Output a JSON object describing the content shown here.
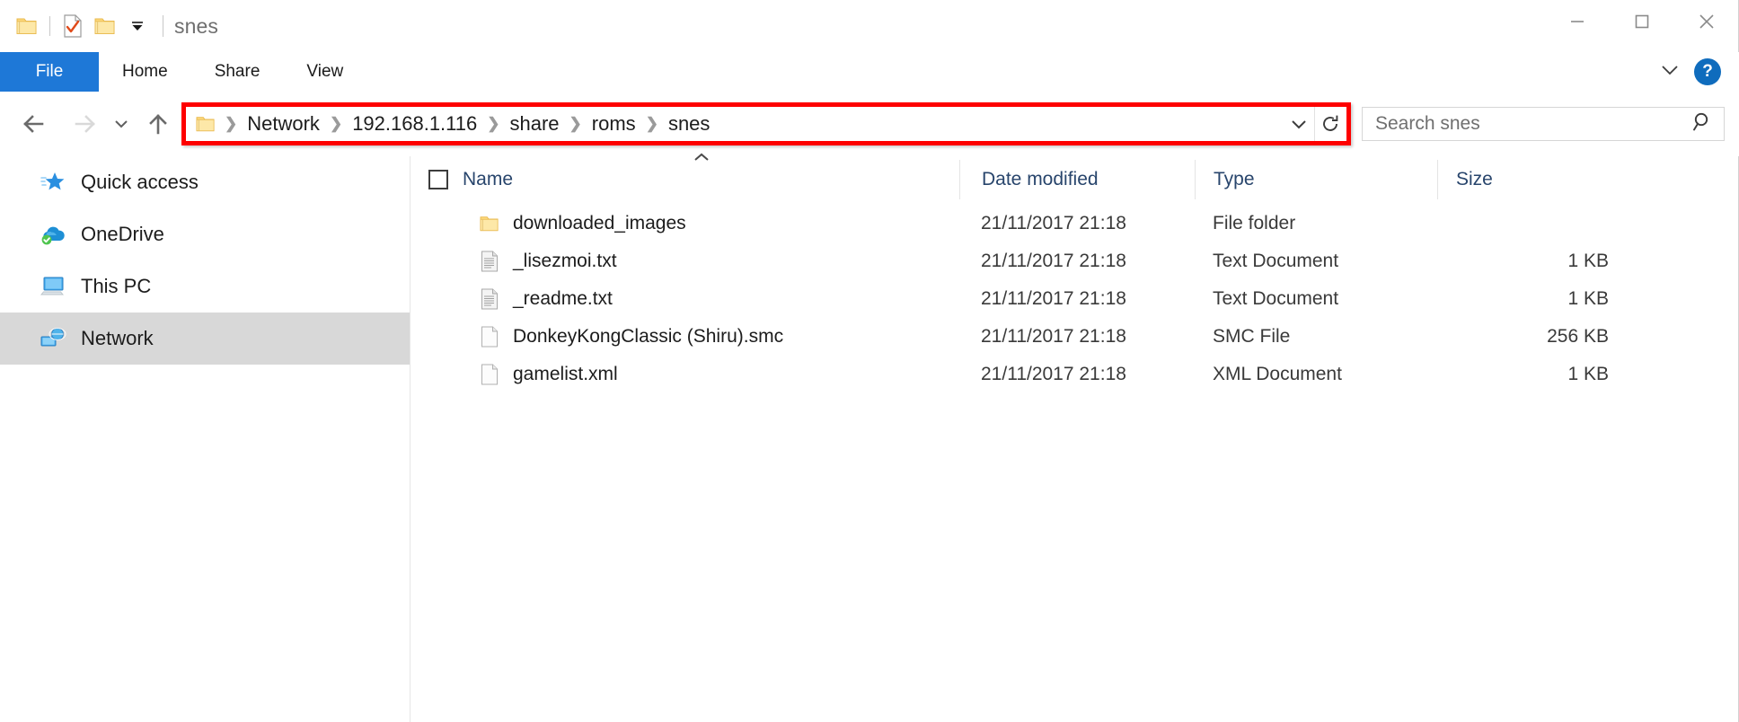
{
  "window": {
    "title": "snes",
    "quick_access_toolbar": [
      {
        "name": "folder-icon",
        "label": "Explorer"
      },
      {
        "name": "properties-icon",
        "label": "Properties"
      },
      {
        "name": "new-folder-icon",
        "label": "New folder"
      },
      {
        "name": "chevron-down-icon",
        "label": "Customize Quick Access Toolbar"
      }
    ],
    "controls": {
      "minimize": "Minimize",
      "maximize": "Maximize",
      "close": "Close"
    }
  },
  "ribbon": {
    "tabs": [
      {
        "label": "File",
        "active": true
      },
      {
        "label": "Home",
        "active": false
      },
      {
        "label": "Share",
        "active": false
      },
      {
        "label": "View",
        "active": false
      }
    ],
    "collapse_label": "Minimize the Ribbon",
    "help_label": "?"
  },
  "navigation": {
    "back": "Back",
    "forward": "Forward",
    "recent": "Recent locations",
    "up": "Up to share"
  },
  "address": {
    "crumbs": [
      "Network",
      "192.168.1.116",
      "share",
      "roms",
      "snes"
    ],
    "separator": "❯",
    "dropdown": "Previous locations",
    "refresh": "Refresh",
    "highlight_color": "#fe0000"
  },
  "search": {
    "placeholder": "Search snes",
    "icon": "search-icon"
  },
  "sidebar": {
    "items": [
      {
        "label": "Quick access",
        "icon": "star-icon",
        "selected": false
      },
      {
        "label": "OneDrive",
        "icon": "cloud-icon",
        "selected": false
      },
      {
        "label": "This PC",
        "icon": "monitor-icon",
        "selected": false
      },
      {
        "label": "Network",
        "icon": "network-icon",
        "selected": true
      }
    ]
  },
  "file_list": {
    "sort_column": "Name",
    "sort_direction": "ascending",
    "columns": [
      "Name",
      "Date modified",
      "Type",
      "Size"
    ],
    "rows": [
      {
        "name": "downloaded_images",
        "date": "21/11/2017 21:18",
        "type": "File folder",
        "size": "",
        "icon": "folder-icon"
      },
      {
        "name": "_lisezmoi.txt",
        "date": "21/11/2017 21:18",
        "type": "Text Document",
        "size": "1 KB",
        "icon": "text-file-icon"
      },
      {
        "name": "_readme.txt",
        "date": "21/11/2017 21:18",
        "type": "Text Document",
        "size": "1 KB",
        "icon": "text-file-icon"
      },
      {
        "name": "DonkeyKongClassic (Shiru).smc",
        "date": "21/11/2017 21:18",
        "type": "SMC File",
        "size": "256 KB",
        "icon": "generic-file-icon"
      },
      {
        "name": "gamelist.xml",
        "date": "21/11/2017 21:18",
        "type": "XML Document",
        "size": "1 KB",
        "icon": "generic-file-icon"
      }
    ]
  },
  "colors": {
    "accent": "#1e78d7",
    "header_text": "#28456c",
    "selection": "#d8d8d8",
    "highlight": "#fe0000"
  }
}
